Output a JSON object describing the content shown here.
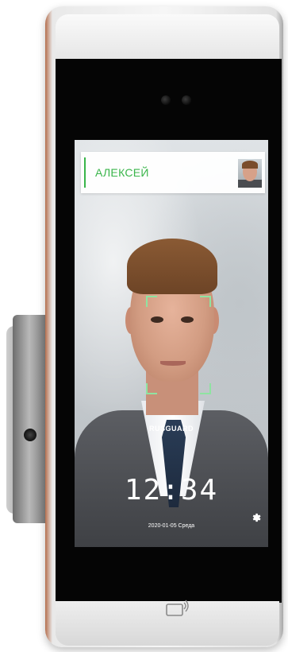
{
  "card": {
    "name": "АЛЕКСЕЙ"
  },
  "screen": {
    "brand": "RUSGUARD",
    "clock": "12:34",
    "date": "2020-01-05 Среда"
  },
  "icons": {
    "settings": "gear-icon",
    "nfc": "nfc-card-icon",
    "camera": "camera-lens-icon"
  },
  "colors": {
    "accent": "#39b54a",
    "frame": "#8fe3a1"
  }
}
